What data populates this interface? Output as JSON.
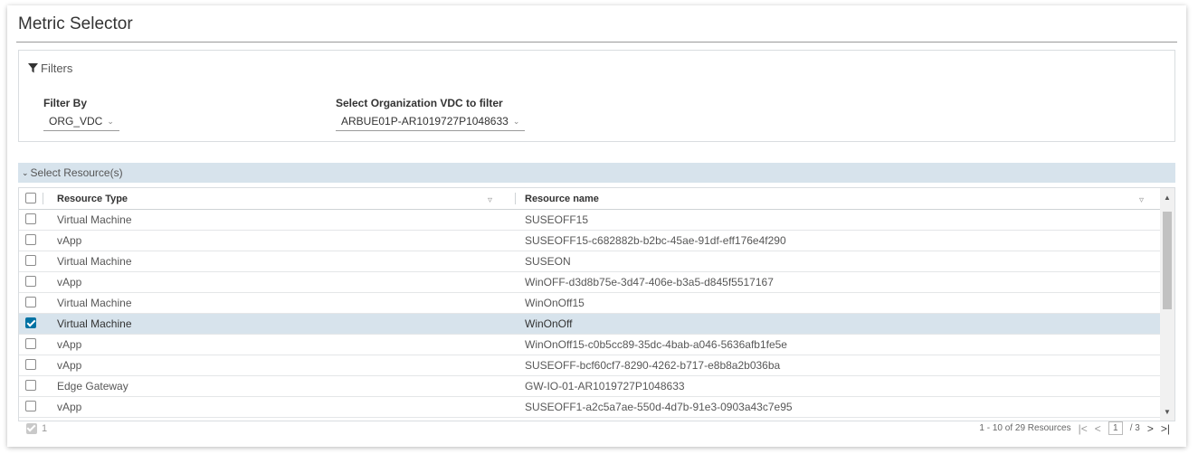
{
  "title": "Metric Selector",
  "filters": {
    "heading": "Filters",
    "filter_by": {
      "label": "Filter By",
      "value": "ORG_VDC"
    },
    "org_vdc": {
      "label": "Select Organization VDC to filter",
      "value": "ARBUE01P-AR1019727P1048633"
    }
  },
  "resources": {
    "heading": "Select Resource(s)",
    "columns": [
      "Resource Type",
      "Resource name"
    ],
    "rows": [
      {
        "type": "Virtual Machine",
        "name": "SUSEOFF15",
        "checked": false
      },
      {
        "type": "vApp",
        "name": "SUSEOFF15-c682882b-b2bc-45ae-91df-eff176e4f290",
        "checked": false
      },
      {
        "type": "Virtual Machine",
        "name": "SUSEON",
        "checked": false
      },
      {
        "type": "vApp",
        "name": "WinOFF-d3d8b75e-3d47-406e-b3a5-d845f5517167",
        "checked": false
      },
      {
        "type": "Virtual Machine",
        "name": "WinOnOff15",
        "checked": false
      },
      {
        "type": "Virtual Machine",
        "name": "WinOnOff",
        "checked": true
      },
      {
        "type": "vApp",
        "name": "WinOnOff15-c0b5cc89-35dc-4bab-a046-5636afb1fe5e",
        "checked": false
      },
      {
        "type": "vApp",
        "name": "SUSEOFF-bcf60cf7-8290-4262-b717-e8b8a2b036ba",
        "checked": false
      },
      {
        "type": "Edge Gateway",
        "name": "GW-IO-01-AR1019727P1048633",
        "checked": false
      },
      {
        "type": "vApp",
        "name": "SUSEOFF1-a2c5a7ae-550d-4d7b-91e3-0903a43c7e95",
        "checked": false
      }
    ],
    "footer": {
      "selected_count": "1",
      "range_text": "1 - 10 of 29 Resources",
      "page": "1",
      "page_total": "/ 3"
    }
  }
}
